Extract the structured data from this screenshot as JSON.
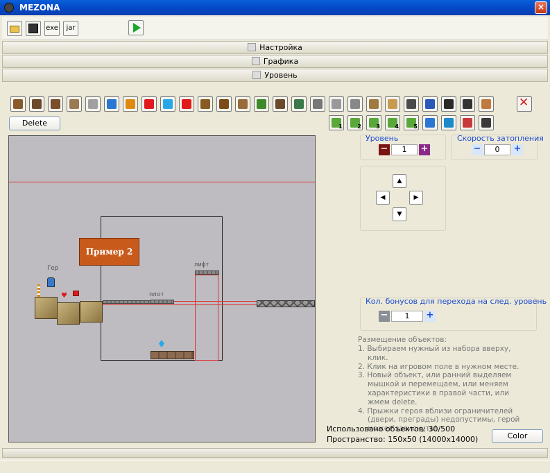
{
  "window": {
    "title": "MEZONA",
    "close_label": "×"
  },
  "toolbar": {
    "exe_label": "exe",
    "jar_label": "jar"
  },
  "panels": {
    "settings": "Настройка",
    "graphics": "Графика",
    "level": "Уровень"
  },
  "palette": {
    "row1": [
      {
        "icon": "wall-block-icon",
        "color": "#8B5A2B"
      },
      {
        "icon": "gate-icon",
        "color": "#6B4A2B"
      },
      {
        "icon": "log-icon",
        "color": "#7A4E2A"
      },
      {
        "icon": "fence-icon",
        "color": "#9A7A50"
      },
      {
        "icon": "grate-icon",
        "color": "#A0A0A0"
      },
      {
        "icon": "water-icon",
        "color": "#2A76D2"
      },
      {
        "icon": "torch-icon",
        "color": "#E08A10"
      },
      {
        "icon": "heart-icon",
        "color": "#E0191F"
      },
      {
        "icon": "crystal-icon",
        "color": "#29A7E8"
      },
      {
        "icon": "flag-icon",
        "color": "#E01B1B"
      },
      {
        "icon": "monster-icon",
        "color": "#8A5A20"
      },
      {
        "icon": "monster2-icon",
        "color": "#7A4A18"
      },
      {
        "icon": "bird-icon",
        "color": "#9A6A3A"
      },
      {
        "icon": "plant-icon",
        "color": "#3E8A2A"
      },
      {
        "icon": "cannon-icon",
        "color": "#6A4A2A"
      },
      {
        "icon": "door-icon",
        "color": "#3A7A4A"
      },
      {
        "icon": "key-icon",
        "color": "#777777"
      },
      {
        "icon": "lock-icon",
        "color": "#999999"
      },
      {
        "icon": "lock2-icon",
        "color": "#888888"
      },
      {
        "icon": "lever-icon",
        "color": "#A07A40"
      },
      {
        "icon": "scroll-icon",
        "color": "#C89A50"
      },
      {
        "icon": "boot-icon",
        "color": "#4A4A4A"
      },
      {
        "icon": "list-icon",
        "color": "#2A5AB8"
      },
      {
        "icon": "pirate-icon",
        "color": "#2A2A2A"
      },
      {
        "icon": "gun-icon",
        "color": "#333333"
      },
      {
        "icon": "hero-icon",
        "color": "#C07A40"
      }
    ],
    "row2": [
      {
        "icon": "tree1-icon",
        "color": "#5AA83A",
        "label": "1"
      },
      {
        "icon": "tree2-icon",
        "color": "#5AA83A",
        "label": "2"
      },
      {
        "icon": "tree3-icon",
        "color": "#5AA83A",
        "label": "3"
      },
      {
        "icon": "tree4-icon",
        "color": "#5AA83A",
        "label": "4"
      },
      {
        "icon": "tree5-icon",
        "color": "#5AA83A",
        "label": "5"
      },
      {
        "icon": "water-block-icon",
        "color": "#2A76D2"
      },
      {
        "icon": "portal-icon",
        "color": "#1A8AC8"
      },
      {
        "icon": "skull-icon",
        "color": "#C83A3A"
      },
      {
        "icon": "empty-icon",
        "color": "#3A3A3A"
      }
    ],
    "delete_icon": "red-x-icon",
    "delete_button": "Delete"
  },
  "canvas": {
    "badge": "Пример 2",
    "hero_label": "Гер",
    "raft_label": "плот",
    "lift_label": "лифт"
  },
  "level": {
    "label": "Уровень",
    "value": "1"
  },
  "flood": {
    "label": "Скорость затопления",
    "value": "0"
  },
  "bonus": {
    "label": "Кол. бонусов для перехода на след. уровень",
    "value": "1"
  },
  "nav": {
    "up": "▲",
    "down": "▼",
    "left": "◀",
    "right": "▶"
  },
  "help": {
    "title": "Размещение объектов:",
    "items": [
      "1.  Выбираем нужный из набора вверху, клик.",
      "2.  Клик на игровом поле в нужном месте.",
      "3.  Новый объект, или ранний выделяем мышкой и перемещаем, или меняем характеристики в правой части, или жмем delete.",
      "4.  Прыжки героя вблизи ограничителей (двери, преграды) недопустимы, герой может зависнуть!"
    ]
  },
  "status": {
    "used": "Использовано объектов: 30/500",
    "space": "Пространство: 150x50  (14000x14000)"
  },
  "color_button": "Color"
}
